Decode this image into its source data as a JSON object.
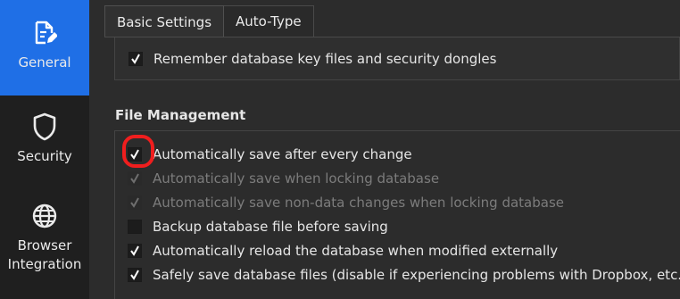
{
  "sidebar": {
    "items": [
      {
        "label": "General",
        "icon": "document-edit-icon",
        "active": true
      },
      {
        "label": "Security",
        "icon": "shield-icon",
        "active": false
      },
      {
        "label": "Browser\nIntegration",
        "icon": "globe-icon",
        "active": false
      }
    ],
    "browser_line1": "Browser",
    "browser_line2": "Integration"
  },
  "tabs": [
    {
      "label": "Basic Settings",
      "active": true
    },
    {
      "label": "Auto-Type",
      "active": false
    }
  ],
  "top_option": {
    "label": "Remember database key files and security dongles",
    "checked": true
  },
  "file_management": {
    "title": "File Management",
    "options": [
      {
        "label": "Automatically save after every change",
        "checked": true,
        "enabled": true,
        "annotated": true
      },
      {
        "label": "Automatically save when locking database",
        "checked": true,
        "enabled": false
      },
      {
        "label": "Automatically save non-data changes when locking database",
        "checked": true,
        "enabled": false
      },
      {
        "label": "Backup database file before saving",
        "checked": false,
        "enabled": true
      },
      {
        "label": "Automatically reload the database when modified externally",
        "checked": true,
        "enabled": true
      },
      {
        "label": "Safely save database files (disable if experiencing problems with Dropbox, etc.)",
        "checked": true,
        "enabled": true
      }
    ]
  },
  "colors": {
    "accent": "#1f6fe6",
    "annotation": "#f01e1e",
    "background": "#2c2c2c",
    "sidebar": "#1f1f1f"
  }
}
